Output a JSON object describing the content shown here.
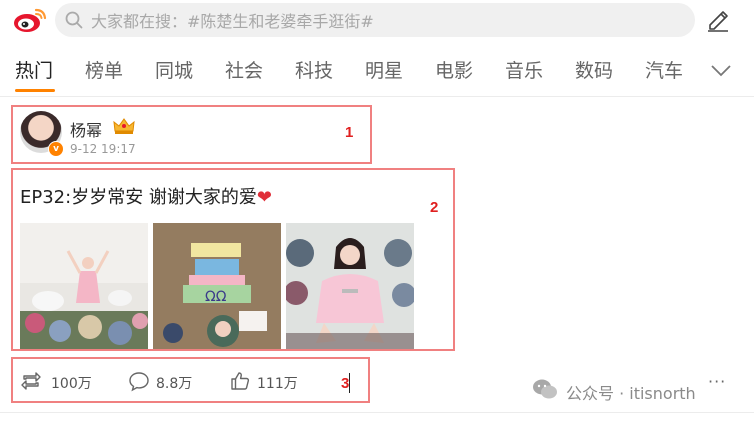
{
  "header": {
    "logo_icon": "weibo-logo-icon",
    "search_placeholder": "大家都在搜：#陈楚生和老婆牵手逛街#",
    "compose_icon": "edit-pencil-icon"
  },
  "tabs": [
    {
      "label": "热门",
      "active": true
    },
    {
      "label": "榜单"
    },
    {
      "label": "同城"
    },
    {
      "label": "社会"
    },
    {
      "label": "科技"
    },
    {
      "label": "明星"
    },
    {
      "label": "电影"
    },
    {
      "label": "音乐"
    },
    {
      "label": "数码"
    },
    {
      "label": "汽车"
    }
  ],
  "post": {
    "user": {
      "name": "杨幂",
      "verified_badge": "v"
    },
    "time": "9-12 19:17",
    "text": "EP32:岁岁常安 谢谢大家的爱",
    "emoji": "❤",
    "images": [
      {
        "name": "photo-balloons-flowers"
      },
      {
        "name": "photo-birthday-cake-art"
      },
      {
        "name": "photo-pink-sweater-flowers"
      }
    ],
    "actions": {
      "repost": "100万",
      "comment": "8.8万",
      "like": "111万"
    }
  },
  "annotations": [
    "1",
    "2",
    "3"
  ],
  "watermark": "公众号 · itisnorth",
  "more": "···",
  "colors": {
    "accent": "#ff8200",
    "annotation_box": "#f08080",
    "annotation_number": "#e02020"
  }
}
